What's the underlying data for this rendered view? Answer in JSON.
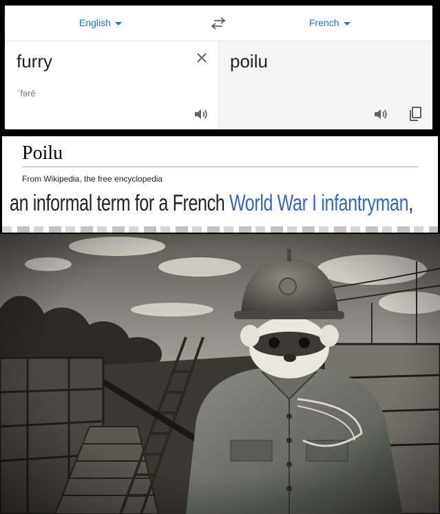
{
  "translator": {
    "source_language": "English",
    "target_language": "French",
    "source_text": "furry",
    "phonetic": "ˈfərē",
    "translated_text": "poilu",
    "icons": [
      "swap-languages-icon",
      "clear-icon",
      "speaker-icon",
      "copy-icon"
    ],
    "accent_color": "#1a73e8"
  },
  "wikipedia": {
    "title": "Poilu",
    "subtitle": "From Wikipedia, the free encyclopedia",
    "text_before_link": "an informal term for a French ",
    "link_text": "World War I infantryman",
    "text_after_link": ",",
    "link_color": "#3366cc"
  },
  "photo": {
    "subject": "ferret-soldier-in-trench"
  }
}
